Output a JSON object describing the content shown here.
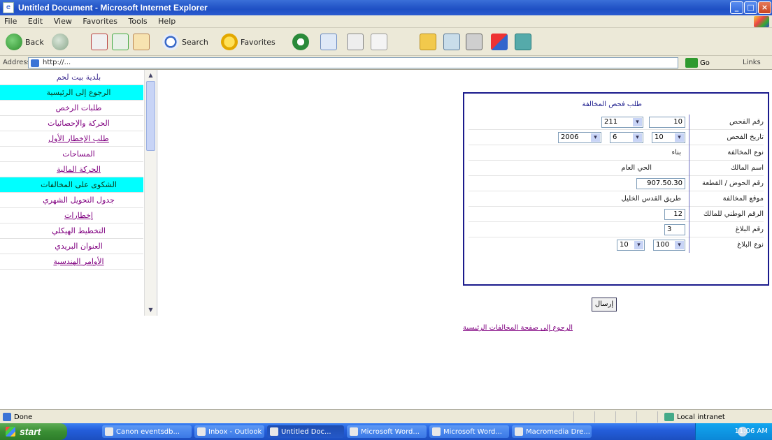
{
  "window": {
    "title": "Untitled Document - Microsoft Internet Explorer",
    "minimize": "_",
    "maximize": "□",
    "close": "×"
  },
  "menu": [
    "File",
    "Edit",
    "View",
    "Favorites",
    "Tools",
    "Help"
  ],
  "toolbar": {
    "back": "Back",
    "search": "Search",
    "favorites": "Favorites"
  },
  "address": {
    "label": "Address",
    "value": "http://...",
    "go": "Go",
    "links": "Links"
  },
  "sidebar": {
    "items": [
      {
        "label": "بلدية بيت لحم",
        "style": "header"
      },
      {
        "label": "الرجوع إلى الرئيسية",
        "style": "hl"
      },
      {
        "label": "طلبات الرخص",
        "style": "normal"
      },
      {
        "label": "الحركة والإحصائيات",
        "style": "normal"
      },
      {
        "label": "طلب الإخطار الأول",
        "style": "ul"
      },
      {
        "label": "المساحات",
        "style": "normal"
      },
      {
        "label": "الحركة المالية",
        "style": "ul"
      },
      {
        "label": "الشكوى على المخالفات",
        "style": "hl"
      },
      {
        "label": "جدول التحويل الشهري",
        "style": "normal"
      },
      {
        "label": "إخطارات",
        "style": "ul"
      },
      {
        "label": "التخطيط الهيكلي",
        "style": "normal"
      },
      {
        "label": "العنوان البريدي",
        "style": "normal"
      },
      {
        "label": "الأوامر الهندسية",
        "style": "ul"
      }
    ]
  },
  "form": {
    "header": "طلب فحص المخالفة",
    "rows": {
      "r1_label": "رقم الفحص",
      "r1_a": "211",
      "r1_b": "10",
      "r2_label": "تاريخ الفحص",
      "r2_year": "2006",
      "r2_month": "6",
      "r2_day": "10",
      "r3_label": "نوع المخالفة",
      "r3_value": "بناء",
      "r4_label": "اسم المالك",
      "r4_value": "الحي العام",
      "r5_label": "رقم الحوض / القطعة",
      "r5_value": "907.50.30",
      "r6_label": "موقع المخالفة",
      "r6_value": "طريق القدس الخليل",
      "r7_label": "الرقم الوطني للمالك",
      "r7_value": "12",
      "r8_label": "رقم البلاغ",
      "r8_value": "3",
      "r9_label": "نوع البلاغ",
      "r9_a": "100",
      "r9_b": "10"
    },
    "submit": "إرسال",
    "bottom_link": "الرجوع إلى صفحة المخالفات الرئيسية"
  },
  "status": {
    "left": "Done",
    "zone": "Local intranet"
  },
  "taskbar": {
    "start": "start",
    "tasks": [
      "Canon eventsdb...",
      "Inbox - Outlook",
      "Untitled Doc...",
      "Microsoft Word...",
      "Microsoft Word...",
      "Macromedia Dre..."
    ],
    "clock": "11:06 AM"
  }
}
